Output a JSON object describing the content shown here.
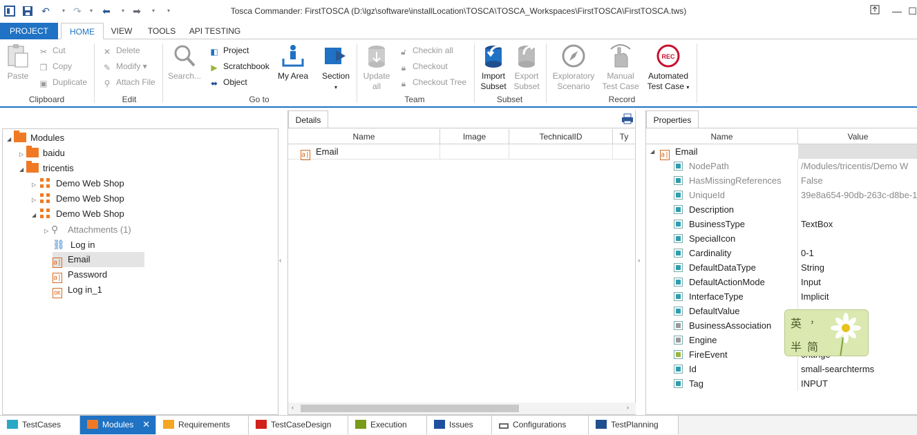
{
  "window": {
    "title": "Tosca Commander: FirstTOSCA (D:\\lgz\\software\\installLocation\\TOSCA\\TOSCA_Workspaces\\FirstTOSCA\\FirstTOSCA.tws)"
  },
  "menu": {
    "tabs": [
      "PROJECT",
      "HOME",
      "VIEW",
      "TOOLS",
      "API TESTING"
    ]
  },
  "ribbon": {
    "clipboard": {
      "paste": "Paste",
      "cut": "Cut",
      "copy": "Copy",
      "duplicate": "Duplicate",
      "label": "Clipboard"
    },
    "edit": {
      "delete": "Delete",
      "modify": "Modify",
      "attach": "Attach File",
      "label": "Edit"
    },
    "goto": {
      "search": "Search...",
      "project": "Project",
      "scratchbook": "Scratchbook",
      "object": "Object",
      "myarea": "My Area",
      "section": "Section",
      "label": "Go to"
    },
    "team": {
      "update1": "Update",
      "update2": "all",
      "checkinall": "Checkin all",
      "checkout": "Checkout",
      "checkouttree": "Checkout Tree",
      "label": "Team"
    },
    "subset": {
      "import1": "Import",
      "import2": "Subset",
      "export1": "Export",
      "export2": "Subset",
      "label": "Subset"
    },
    "record": {
      "expl1": "Exploratory",
      "expl2": "Scenario",
      "manual1": "Manual",
      "manual2": "Test Case",
      "auto1": "Automated",
      "auto2": "Test Case",
      "rec": "REC",
      "label": "Record"
    }
  },
  "tree": {
    "root": "Modules",
    "items": [
      "baidu",
      "tricentis",
      "Demo Web Shop",
      "Demo Web Shop",
      "Demo Web Shop",
      "Attachments (1)",
      "Log in",
      "Email",
      "Password",
      "Log in_1"
    ]
  },
  "details": {
    "tab": "Details",
    "columns": [
      "Name",
      "Image",
      "TechnicalID",
      "Ty"
    ],
    "row_name": "Email"
  },
  "properties": {
    "tab": "Properties",
    "columns": [
      "Name",
      "Value"
    ],
    "root": "Email",
    "rows": [
      {
        "name": "NodePath",
        "value": "/Modules/tricentis/Demo W"
      },
      {
        "name": "HasMissingReferences",
        "value": "False"
      },
      {
        "name": "UniqueId",
        "value": "39e8a654-90db-263c-d8be-1"
      },
      {
        "name": "Description",
        "value": ""
      },
      {
        "name": "BusinessType",
        "value": "TextBox"
      },
      {
        "name": "SpecialIcon",
        "value": ""
      },
      {
        "name": "Cardinality",
        "value": "0-1"
      },
      {
        "name": "DefaultDataType",
        "value": "String"
      },
      {
        "name": "DefaultActionMode",
        "value": "Input"
      },
      {
        "name": "InterfaceType",
        "value": "Implicit"
      },
      {
        "name": "DefaultValue",
        "value": ""
      },
      {
        "name": "BusinessAssociation",
        "value": ""
      },
      {
        "name": "Engine",
        "value": ""
      },
      {
        "name": "FireEvent",
        "value": "change"
      },
      {
        "name": "Id",
        "value": "small-searchterms"
      },
      {
        "name": "Tag",
        "value": "INPUT"
      }
    ]
  },
  "ime": {
    "c1": "英",
    "c2": "，",
    "c3": "半",
    "c4": "简"
  },
  "bottom_tabs": [
    "TestCases",
    "Modules",
    "Requirements",
    "TestCaseDesign",
    "Execution",
    "Issues",
    "Configurations",
    "TestPlanning"
  ],
  "colors": {
    "accent": "#1f72c4",
    "folder": "#f07a24",
    "rec": "#c8102e"
  }
}
